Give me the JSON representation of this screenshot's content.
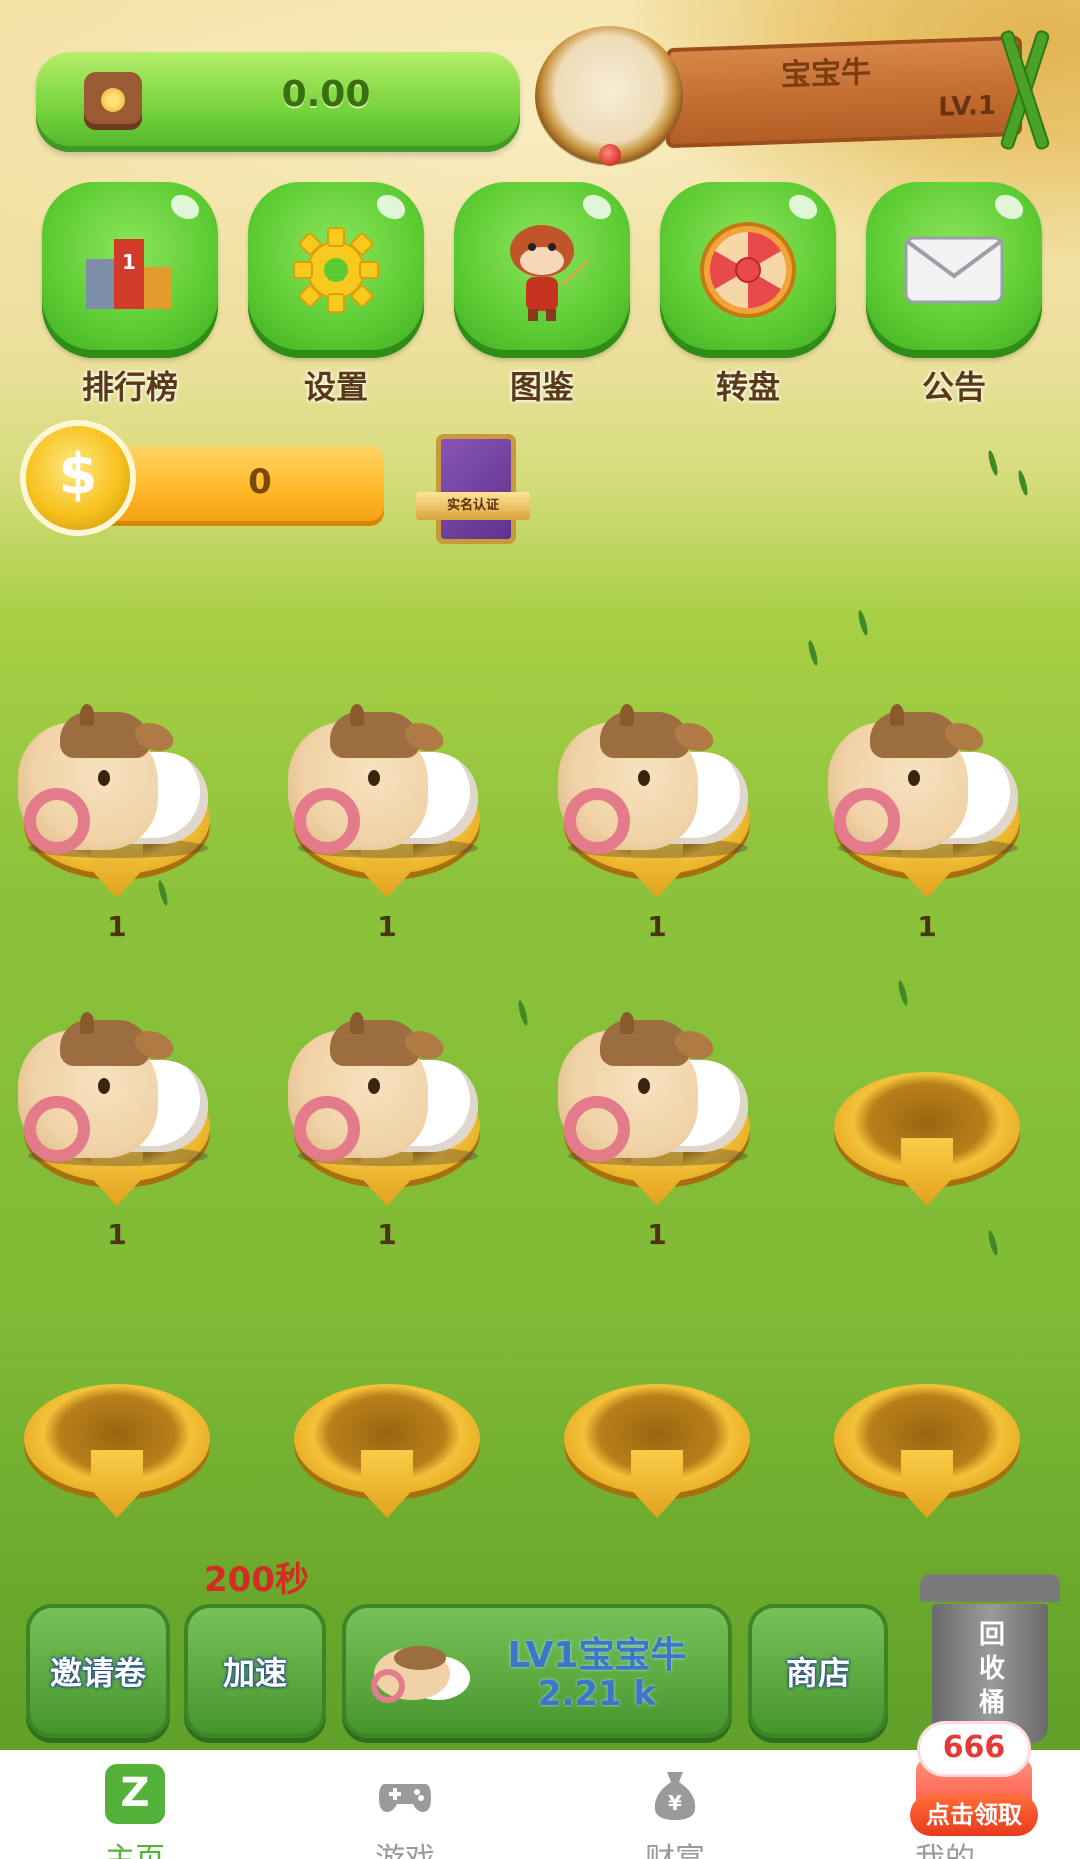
{
  "header": {
    "balance": "0.00",
    "player_name": "宝宝牛",
    "player_level": "LV.1"
  },
  "menu": [
    {
      "label": "排行榜",
      "icon": "ranking-podium-icon"
    },
    {
      "label": "设置",
      "icon": "gear-icon"
    },
    {
      "label": "图鉴",
      "icon": "cow-teacher-icon"
    },
    {
      "label": "转盘",
      "icon": "wheel-icon"
    },
    {
      "label": "公告",
      "icon": "envelope-icon"
    }
  ],
  "coins": {
    "value": "0",
    "symbol": "$"
  },
  "realname_badge": "实名认证",
  "slots": [
    {
      "occupied": true,
      "level": "1"
    },
    {
      "occupied": true,
      "level": "1"
    },
    {
      "occupied": true,
      "level": "1"
    },
    {
      "occupied": true,
      "level": "1"
    },
    {
      "occupied": true,
      "level": "1"
    },
    {
      "occupied": true,
      "level": "1"
    },
    {
      "occupied": true,
      "level": "1"
    },
    {
      "occupied": false,
      "level": ""
    },
    {
      "occupied": false,
      "level": ""
    },
    {
      "occupied": false,
      "level": ""
    },
    {
      "occupied": false,
      "level": ""
    },
    {
      "occupied": false,
      "level": ""
    }
  ],
  "actions": {
    "invite_label": "邀请卷",
    "speed_label": "加速",
    "speed_timer": "200秒",
    "buy_name": "LV1宝宝牛",
    "buy_price": "2.21 k",
    "shop_label": "商店",
    "trash_label": "回收桶"
  },
  "nav": {
    "tabs": [
      {
        "label": "主页",
        "icon": "home-icon",
        "active": true
      },
      {
        "label": "游戏",
        "icon": "gamepad-icon",
        "active": false
      },
      {
        "label": "财富",
        "icon": "money-bag-icon",
        "active": false
      },
      {
        "label": "我的",
        "icon": "profile-icon",
        "active": false
      }
    ]
  },
  "promo": {
    "count": "666",
    "cta": "点击领取"
  },
  "colors": {
    "accent_green": "#54b23a",
    "coin_orange": "#ffb828",
    "timer_red": "#d42b22",
    "buy_text_blue": "#3b76c8"
  }
}
